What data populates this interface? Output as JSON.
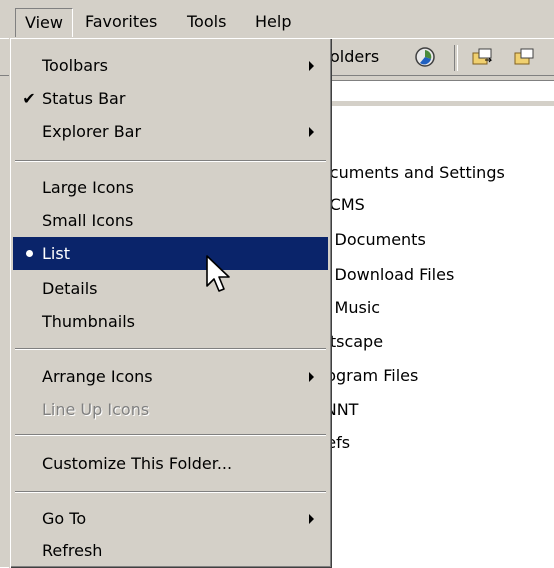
{
  "menubar": {
    "items": [
      "View",
      "Favorites",
      "Tools",
      "Help"
    ],
    "active": "View"
  },
  "toolbar": {
    "folders_label": "olders"
  },
  "files": [
    "ocuments and Settings",
    "PCMS",
    "y Documents",
    "y Download Files",
    "y Music",
    "etscape",
    "rogram Files",
    "INNT",
    "refs"
  ],
  "view_menu": {
    "toolbars": "Toolbars",
    "status_bar": "Status Bar",
    "explorer_bar": "Explorer Bar",
    "large_icons": "Large Icons",
    "small_icons": "Small Icons",
    "list": "List",
    "details": "Details",
    "thumbnails": "Thumbnails",
    "arrange_icons": "Arrange Icons",
    "line_up_icons": "Line Up Icons",
    "customize": "Customize This Folder...",
    "go_to": "Go To",
    "refresh": "Refresh"
  },
  "colors": {
    "face": "#d4d0c8",
    "highlight": "#0a246a",
    "disabled": "#808080"
  }
}
